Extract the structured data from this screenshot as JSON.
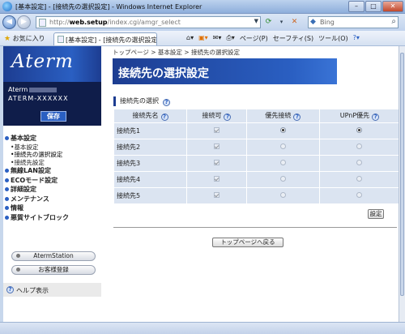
{
  "window": {
    "title": "[基本設定] - [接続先の選択設定] - Windows Internet Explorer",
    "min": "–",
    "max": "□",
    "close": "✕"
  },
  "address": {
    "url_prefix": "http://",
    "url_host": "web.setup",
    "url_path": "/index.cgi/amgr_select",
    "search_placeholder": "Bing"
  },
  "cmdbar": {
    "favorites": "お気に入り",
    "tab_label": "[基本設定] - [接続先の選択設定]",
    "tools": [
      "ページ(P)",
      "セーフティ(S)",
      "ツール(O)"
    ]
  },
  "sidebar": {
    "logo": "Aterm",
    "model_prefix": "Aterm",
    "model_id": "ATERM-XXXXXX",
    "save": "保存",
    "menu": [
      {
        "label": "基本設定",
        "children": [
          "基本設定",
          "接続先の選択設定",
          "接続先設定"
        ]
      },
      {
        "label": "無線LAN設定",
        "children": []
      },
      {
        "label": "ECOモード設定",
        "children": []
      },
      {
        "label": "詳細設定",
        "children": []
      },
      {
        "label": "メンテナンス",
        "children": []
      },
      {
        "label": "情報",
        "children": []
      },
      {
        "label": "悪質サイトブロック",
        "children": []
      }
    ],
    "btn_aterm_station": "AtermStation",
    "btn_register": "お客様登録",
    "help": "ヘルプ表示"
  },
  "main": {
    "breadcrumb": "トップページ > 基本設定 > 接続先の選択設定",
    "heading": "接続先の選択設定",
    "section": "接続先の選択",
    "table": {
      "headers": [
        "接続先名",
        "接続可",
        "優先接続",
        "UPnP優先"
      ],
      "rows": [
        {
          "name": "接続先1",
          "enabled": true,
          "priority": true,
          "upnp": true
        },
        {
          "name": "接続先2",
          "enabled": true,
          "priority": false,
          "upnp": false
        },
        {
          "name": "接続先3",
          "enabled": true,
          "priority": false,
          "upnp": false
        },
        {
          "name": "接続先4",
          "enabled": true,
          "priority": false,
          "upnp": false
        },
        {
          "name": "接続先5",
          "enabled": true,
          "priority": false,
          "upnp": false
        }
      ]
    },
    "set_button": "設定",
    "top_button": "トップページへ戻る"
  }
}
